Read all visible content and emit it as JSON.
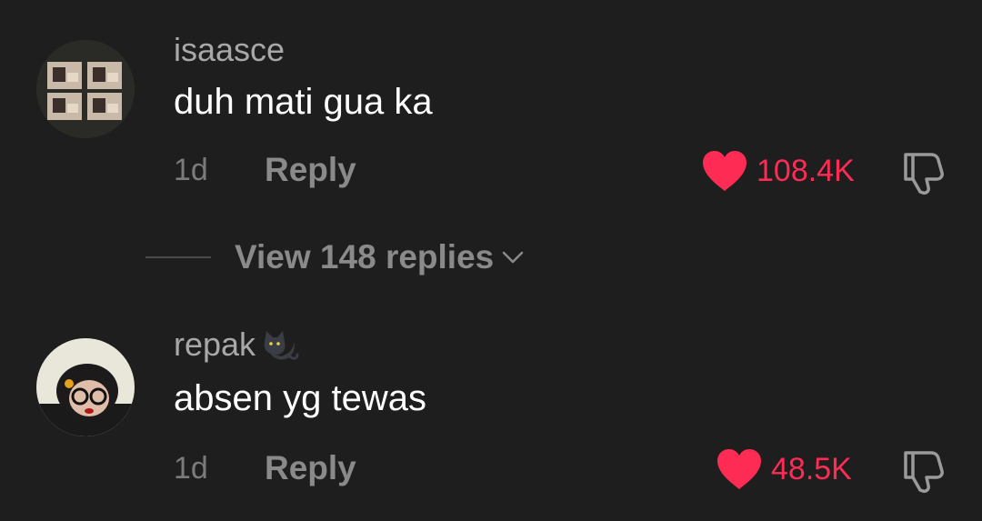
{
  "comments": [
    {
      "username": "isaasce",
      "text": "duh mati gua ka",
      "time": "1d",
      "reply_label": "Reply",
      "likes": "108.4K",
      "avatar_icon": "avatar-image"
    },
    {
      "username": "repak",
      "username_emoji": "cat-icon",
      "text": "absen yg tewas",
      "time": "1d",
      "reply_label": "Reply",
      "likes": "48.5K",
      "avatar_icon": "avatar-image"
    }
  ],
  "view_replies": {
    "label": "View 148 replies",
    "icon": "chevron-down-icon"
  },
  "colors": {
    "background": "#1e1e1e",
    "like": "#fe2c55",
    "username": "#a8a8a8",
    "muted": "#8a8a8a"
  }
}
